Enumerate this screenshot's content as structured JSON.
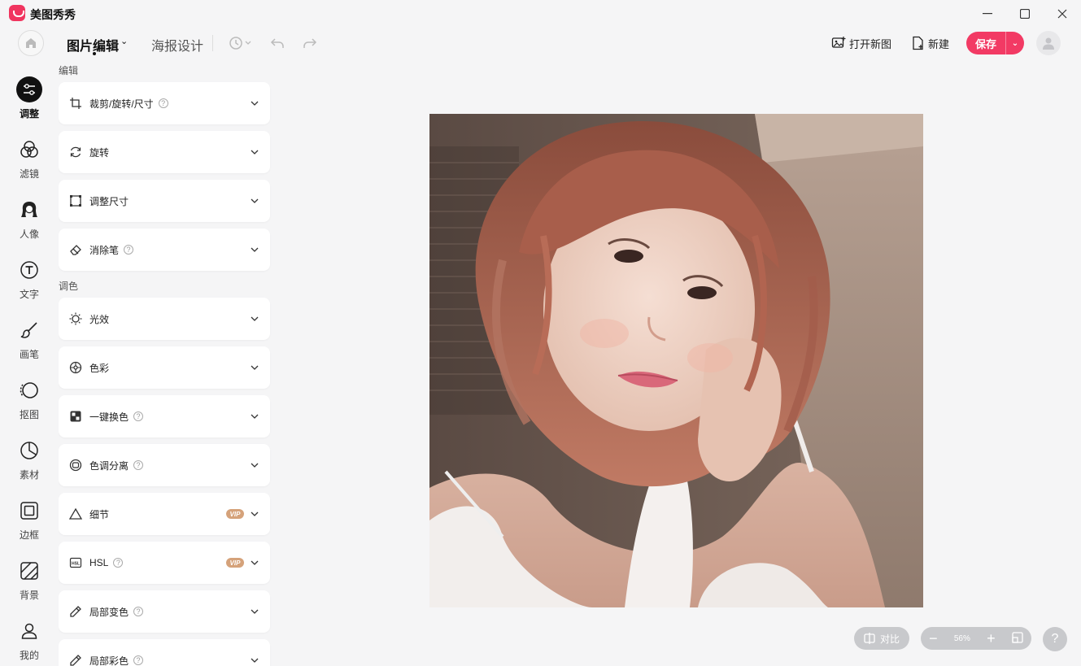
{
  "app": {
    "name": "美图秀秀"
  },
  "tabs": {
    "image_edit": "图片编辑",
    "poster": "海报设计"
  },
  "actions": {
    "open_image": "打开新图",
    "new": "新建",
    "save": "保存"
  },
  "rail": [
    {
      "label": "调整",
      "icon": "adjust-icon",
      "active": true
    },
    {
      "label": "滤镜",
      "icon": "filter-icon"
    },
    {
      "label": "人像",
      "icon": "portrait-icon"
    },
    {
      "label": "文字",
      "icon": "text-icon"
    },
    {
      "label": "画笔",
      "icon": "brush-icon"
    },
    {
      "label": "抠图",
      "icon": "cutout-icon"
    },
    {
      "label": "素材",
      "icon": "sticker-icon"
    },
    {
      "label": "边框",
      "icon": "frame-icon"
    },
    {
      "label": "背景",
      "icon": "background-icon"
    },
    {
      "label": "我的",
      "icon": "user-icon"
    }
  ],
  "panel": {
    "edit_title": "编辑",
    "color_title": "调色",
    "edit_items": [
      {
        "label": "裁剪/旋转/尺寸",
        "help": "?",
        "icon": "crop-icon"
      },
      {
        "label": "旋转",
        "icon": "rotate-icon"
      },
      {
        "label": "调整尺寸",
        "icon": "resize-icon"
      },
      {
        "label": "消除笔",
        "help": "?",
        "icon": "eraser-icon"
      }
    ],
    "color_items": [
      {
        "label": "光效",
        "icon": "light-icon"
      },
      {
        "label": "色彩",
        "icon": "color-icon"
      },
      {
        "label": "一键换色",
        "help": "?",
        "icon": "recolor-icon"
      },
      {
        "label": "色调分离",
        "help": "?",
        "icon": "tone-split-icon"
      },
      {
        "label": "细节",
        "vip": "VIP",
        "icon": "detail-icon"
      },
      {
        "label": "HSL",
        "help": "?",
        "vip": "VIP",
        "icon": "hsl-icon"
      },
      {
        "label": "局部变色",
        "help": "?",
        "icon": "pen-icon"
      },
      {
        "label": "局部彩色",
        "help": "?",
        "icon": "pen-icon"
      }
    ]
  },
  "canvas": {
    "compare": "对比",
    "zoom": "56%",
    "help": "?"
  }
}
